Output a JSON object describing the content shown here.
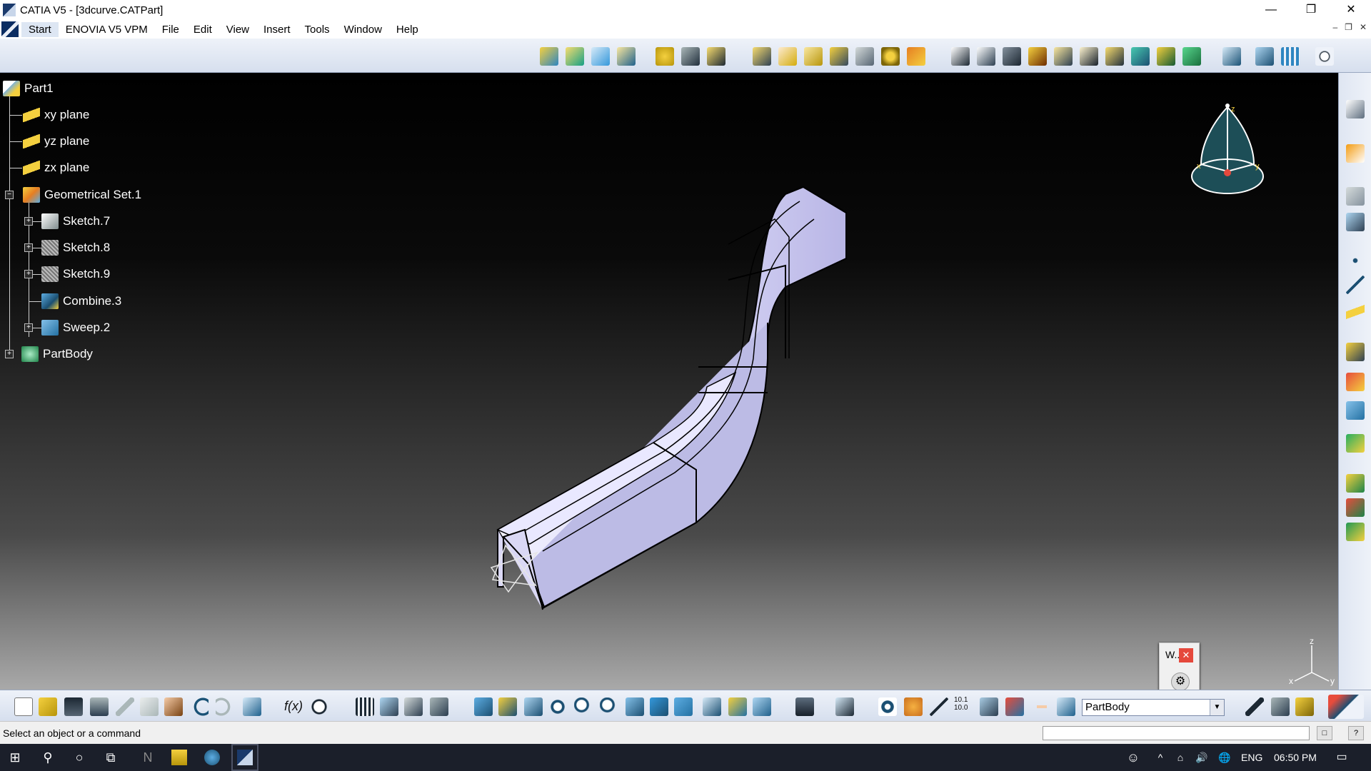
{
  "window": {
    "title": "CATIA V5 - [3dcurve.CATPart]",
    "controls": {
      "minimize": "—",
      "restore": "❐",
      "close": "✕"
    }
  },
  "menubar": {
    "items": [
      "Start",
      "ENOVIA V5 VPM",
      "File",
      "Edit",
      "View",
      "Insert",
      "Tools",
      "Window",
      "Help"
    ],
    "mdi_controls": [
      "–",
      "❐",
      "✕"
    ]
  },
  "tree": {
    "root": "Part1",
    "planes": [
      "xy plane",
      "yz plane",
      "zx plane"
    ],
    "geometrical_set": "Geometrical Set.1",
    "children": [
      "Sketch.7",
      "Sketch.8",
      "Sketch.9",
      "Combine.3",
      "Sweep.2"
    ],
    "body": "PartBody",
    "expanders": [
      "−",
      "+",
      "+",
      "+",
      "+",
      "+"
    ]
  },
  "compass_labels": {
    "z": "z",
    "x": "x",
    "y": "y"
  },
  "axis_labels": {
    "z": "z",
    "x": "x",
    "y": "y"
  },
  "dialog": {
    "title": "W...",
    "close": "✕",
    "button_glyph": "⚙"
  },
  "bottom_toolbar": {
    "current_body": "PartBody",
    "combo_arrow": "▼",
    "texts": {
      "formula": "f(x)",
      "scale": "10.1\n10.0"
    }
  },
  "statusbar": {
    "message": "Select an object or a command",
    "buttons": [
      "□",
      "?"
    ]
  },
  "taskbar": {
    "language": "ENG",
    "time": "06:50 PM",
    "glyphs": {
      "start": "⊞",
      "search": "⚲",
      "cortana": "○",
      "taskview": "⧉",
      "onenote": "N",
      "tray_arrow": "^",
      "network": "⌂",
      "volume": "🔊",
      "globe": "🌐",
      "notifications": "▭"
    }
  },
  "colors": {
    "tree_text": "#ffffff",
    "sweep_face": "#dad8f5",
    "accent_red": "#e5483c"
  }
}
